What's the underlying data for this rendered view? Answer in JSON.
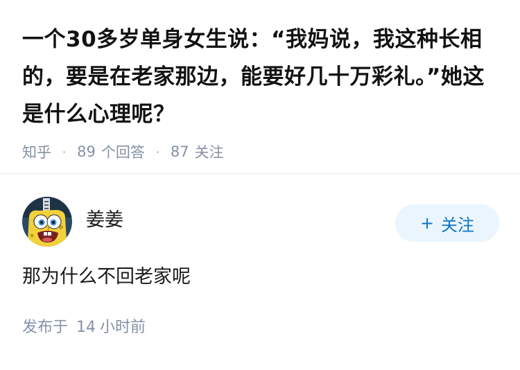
{
  "question": {
    "title": "一个30多岁单身女生说：“我妈说，我这种长相的，要是在老家那边，能要好几十万彩礼。”她这是什么心理呢？",
    "source": "知乎",
    "answer_count": "89",
    "answer_label": "个回答",
    "follower_count": "87",
    "follower_label": "关注"
  },
  "answer": {
    "author_name": "姜姜",
    "avatar_icon": "spongebob-avatar-icon",
    "follow_button": {
      "plus": "+",
      "label": "关注"
    },
    "content": "那为什么不回老家呢",
    "published_label": "发布于",
    "published_value": "14",
    "published_unit": "小时前"
  },
  "colors": {
    "title": "#121212",
    "meta": "#8590a6",
    "follow_bg": "#ebf5fd",
    "follow_text": "#0f75c8"
  }
}
